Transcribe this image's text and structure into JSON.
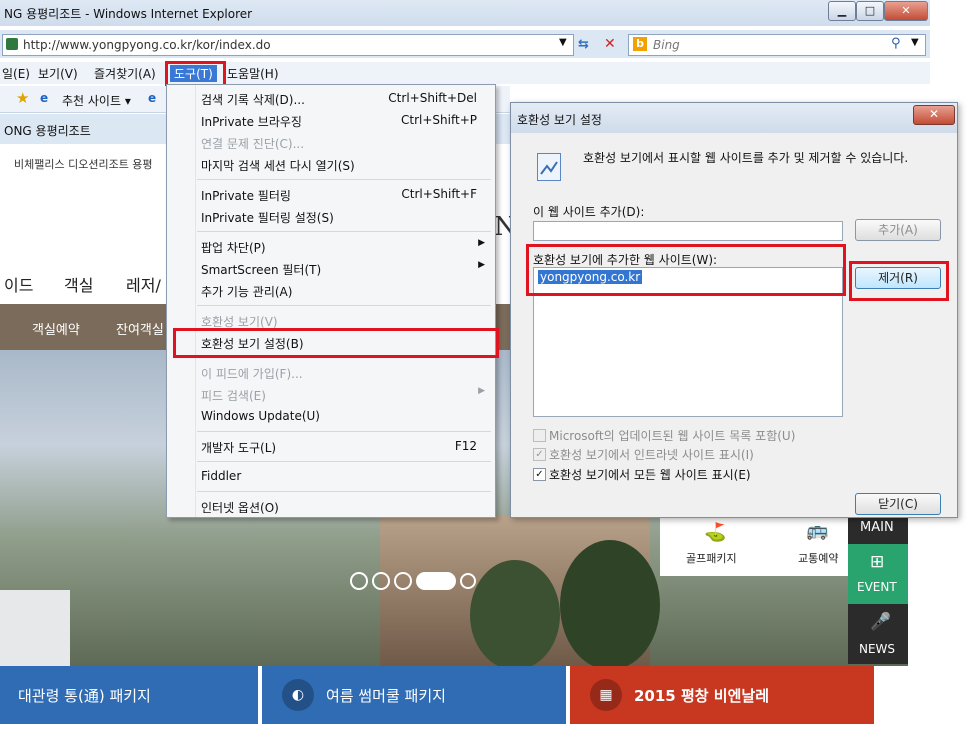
{
  "window": {
    "title": "NG 용평리조트 - Windows Internet Explorer",
    "min": "▁",
    "max": "□",
    "close": "✕"
  },
  "address": {
    "url": "http://www.yongpyong.co.kr/kor/index.do",
    "search_placeholder": "Bing"
  },
  "menubar": {
    "items": [
      "일(E)",
      "보기(V)",
      "즐겨찾기(A)",
      "도구(T)",
      "도움말(H)"
    ]
  },
  "favbar": {
    "suggested": "추천 사이트 ▾"
  },
  "tab": {
    "label": "ONG 용평리조트"
  },
  "site": {
    "top_links": "비체팰리스   디오션리조트   용평",
    "nav": [
      "이드",
      "객실",
      "레저/"
    ],
    "subnav": [
      "객실예약",
      "잔여객실"
    ],
    "quick": [
      "골프패키지",
      "교통예약"
    ],
    "side": [
      "MAIN",
      "EVENT",
      "NEWS"
    ],
    "banners": [
      "대관령 통(通) 패키지",
      "여름 썸머쿨 패키지",
      "2015 평창 비엔날레"
    ],
    "bg_letter": "N"
  },
  "dropdown": {
    "items": [
      {
        "label": "검색 기록 삭제(D)...",
        "shortcut": "Ctrl+Shift+Del",
        "disabled": false,
        "submenu": false
      },
      {
        "label": "InPrivate 브라우징",
        "shortcut": "Ctrl+Shift+P",
        "disabled": false,
        "submenu": false
      },
      {
        "label": "연결 문제 진단(C)...",
        "shortcut": "",
        "disabled": true,
        "submenu": false
      },
      {
        "label": "마지막 검색 세션 다시 열기(S)",
        "shortcut": "",
        "disabled": false,
        "submenu": false
      },
      {
        "label": "InPrivate 필터링",
        "shortcut": "Ctrl+Shift+F",
        "disabled": false,
        "submenu": false
      },
      {
        "label": "InPrivate 필터링 설정(S)",
        "shortcut": "",
        "disabled": false,
        "submenu": false
      },
      {
        "label": "팝업 차단(P)",
        "shortcut": "",
        "disabled": false,
        "submenu": true
      },
      {
        "label": "SmartScreen 필터(T)",
        "shortcut": "",
        "disabled": false,
        "submenu": true
      },
      {
        "label": "추가 기능 관리(A)",
        "shortcut": "",
        "disabled": false,
        "submenu": false
      },
      {
        "label": "호환성 보기(V)",
        "shortcut": "",
        "disabled": true,
        "submenu": false
      },
      {
        "label": "호환성 보기 설정(B)",
        "shortcut": "",
        "disabled": false,
        "submenu": false
      },
      {
        "label": "이 피드에 가입(F)...",
        "shortcut": "",
        "disabled": true,
        "submenu": false
      },
      {
        "label": "피드 검색(E)",
        "shortcut": "",
        "disabled": true,
        "submenu": true
      },
      {
        "label": "Windows Update(U)",
        "shortcut": "",
        "disabled": false,
        "submenu": false
      },
      {
        "label": "개발자 도구(L)",
        "shortcut": "F12",
        "disabled": false,
        "submenu": false
      },
      {
        "label": "Fiddler",
        "shortcut": "",
        "disabled": false,
        "submenu": false
      },
      {
        "label": "인터넷 옵션(O)",
        "shortcut": "",
        "disabled": false,
        "submenu": false
      }
    ]
  },
  "dialog": {
    "title": "호환성 보기 설정",
    "description": "호환성 보기에서 표시할 웹 사이트를 추가 및 제거할 수 있습니다.",
    "add_label": "이 웹 사이트 추가(D):",
    "add_value": "",
    "add_button": "추가(A)",
    "list_label": "호환성 보기에 추가한 웹 사이트(W):",
    "list_items": [
      "yongpyong.co.kr"
    ],
    "remove_button": "제거(R)",
    "options": [
      {
        "label": "Microsoft의 업데이트된 웹 사이트 목록 포함(U)",
        "checked": false,
        "disabled": true
      },
      {
        "label": "호환성 보기에서 인트라넷 사이트 표시(I)",
        "checked": true,
        "disabled": true
      },
      {
        "label": "호환성 보기에서 모든 웹 사이트 표시(E)",
        "checked": true,
        "disabled": false
      }
    ],
    "close_button": "닫기(C)"
  },
  "colors": {
    "highlight_red": "#e0141e",
    "menu_blue": "#3a78d6",
    "banner_blue": "#2f6cb4",
    "banner_red": "#c8371f",
    "event_green": "#2aa46e"
  }
}
